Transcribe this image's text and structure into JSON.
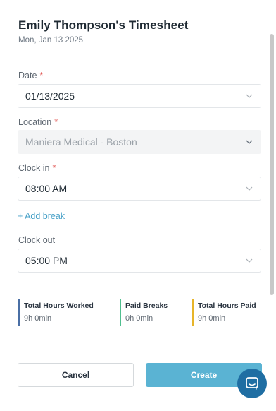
{
  "header": {
    "title": "Emily Thompson's Timesheet",
    "date": "Mon, Jan 13 2025"
  },
  "form": {
    "date": {
      "label": "Date",
      "required": "*",
      "value": "01/13/2025"
    },
    "location": {
      "label": "Location",
      "required": "*",
      "value": "Maniera Medical - Boston",
      "disabled": true
    },
    "clock_in": {
      "label": "Clock in",
      "required": "*",
      "value": "08:00 AM"
    },
    "add_break": "+ Add break",
    "clock_out": {
      "label": "Clock out",
      "value": "05:00 PM"
    }
  },
  "summary": [
    {
      "title": "Total Hours Worked",
      "value": "9h 0min",
      "color": "#4a6fa5"
    },
    {
      "title": "Paid Breaks",
      "value": "0h 0min",
      "color": "#4fbf8f"
    },
    {
      "title": "Total Hours Paid",
      "value": "9h 0min",
      "color": "#e7b52a"
    }
  ],
  "buttons": {
    "cancel": "Cancel",
    "create": "Create"
  },
  "icons": {
    "dropdown": "chevron-down-icon",
    "chat": "chat-bubble-icon"
  },
  "colors": {
    "accent": "#5ab3d3",
    "link": "#4aa2c8",
    "required": "#e0524f",
    "chat": "#1f6ea3"
  }
}
